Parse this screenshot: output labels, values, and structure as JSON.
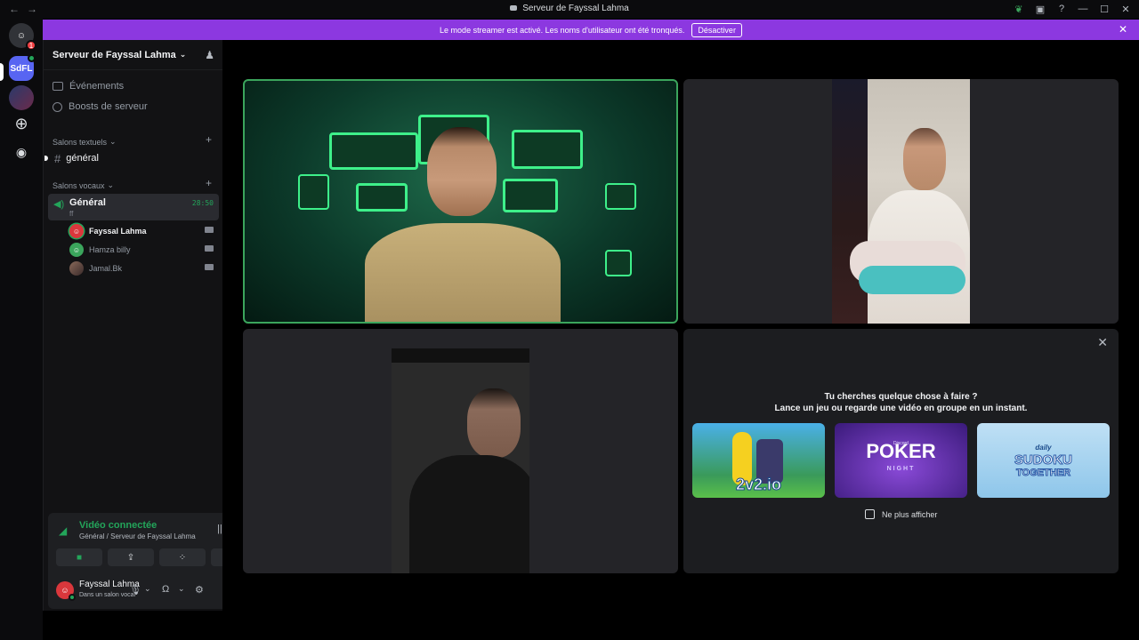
{
  "window": {
    "title": "Serveur de Fayssal Lahma",
    "back_glyph": "←",
    "forward_glyph": "→",
    "min_glyph": "—",
    "max_glyph": "☐",
    "close_glyph": "✕"
  },
  "banner": {
    "text": "Le mode streamer est activé. Les noms d'utilisateur ont été tronqués.",
    "button_label": "Désactiver",
    "close_glyph": "✕"
  },
  "rail": {
    "home_badge": "1",
    "server_abbrev": "SdFL"
  },
  "sidebar": {
    "server_name": "Serveur de Fayssal Lahma",
    "items": [
      {
        "label": "Événements"
      },
      {
        "label": "Boosts de serveur"
      }
    ],
    "text_category": "Salons textuels",
    "text_channels": [
      {
        "name": "général"
      }
    ],
    "voice_category": "Salons vocaux",
    "voice_channel": {
      "name": "Général",
      "timer": "28:50",
      "sub": "ff"
    },
    "members": [
      {
        "name": "Fayssal Lahma"
      },
      {
        "name": "Hamza billy"
      },
      {
        "name": "Jamal.Bk"
      }
    ]
  },
  "connection": {
    "status": "Vidéo connectée",
    "location": "Général / Serveur de Fayssal Lahma"
  },
  "user": {
    "name": "Fayssal Lahma",
    "status": "Dans un salon vocal"
  },
  "activity": {
    "title_line1": "Tu cherches quelque chose à faire ?",
    "title_line2": "Lance un jeu ou regarde une vidéo en groupe en un instant.",
    "cards": [
      {
        "label": "2v2.io"
      },
      {
        "label": "POKER",
        "sub": "NIGHT",
        "brand": "Discord"
      },
      {
        "label": "SUDOKU",
        "top": "daily",
        "bottom": "TOGETHER"
      }
    ],
    "dont_show": "Ne plus afficher"
  },
  "colors": {
    "accent": "#5865f2",
    "green": "#23a55a",
    "banner": "#8c38e0"
  }
}
